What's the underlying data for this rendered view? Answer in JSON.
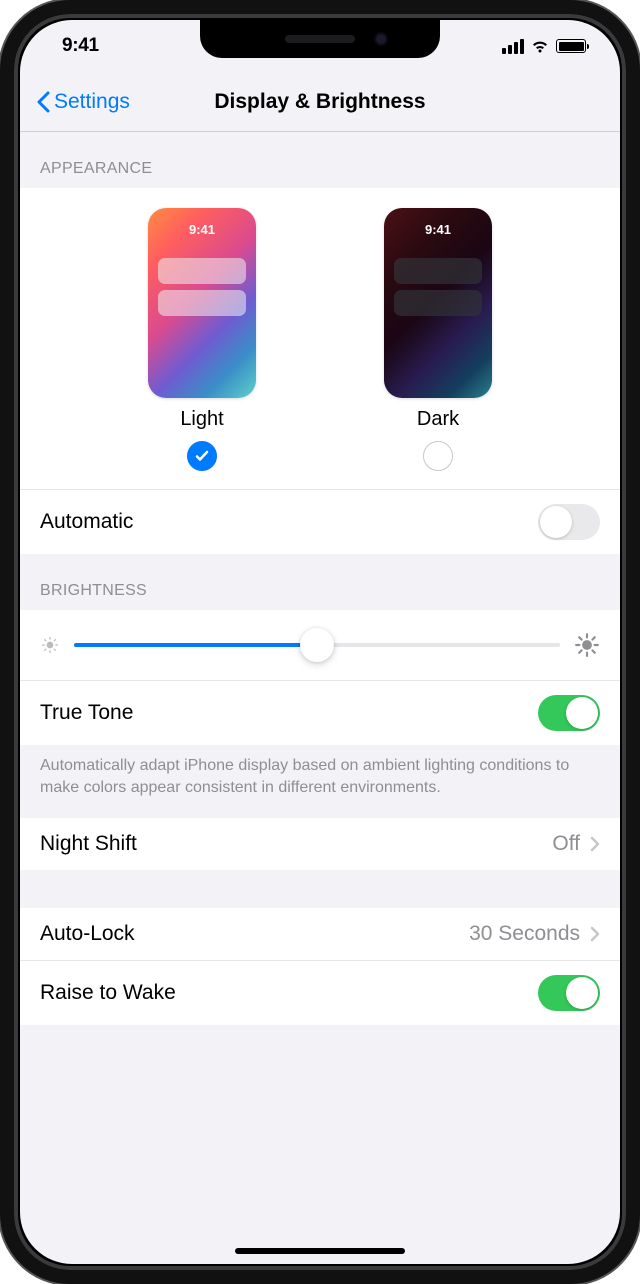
{
  "status": {
    "time": "9:41"
  },
  "nav": {
    "back": "Settings",
    "title": "Display & Brightness"
  },
  "sections": {
    "appearance": {
      "header": "Appearance",
      "options": [
        {
          "label": "Light",
          "time": "9:41",
          "selected": true
        },
        {
          "label": "Dark",
          "time": "9:41",
          "selected": false
        }
      ],
      "automatic": {
        "label": "Automatic",
        "enabled": false
      }
    },
    "brightness": {
      "header": "Brightness",
      "slider_value": 0.5,
      "true_tone": {
        "label": "True Tone",
        "enabled": true
      },
      "true_tone_footer": "Automatically adapt iPhone display based on ambient lighting conditions to make colors appear consistent in different environments."
    },
    "night_shift": {
      "label": "Night Shift",
      "value": "Off"
    },
    "auto_lock": {
      "label": "Auto-Lock",
      "value": "30 Seconds"
    },
    "raise_to_wake": {
      "label": "Raise to Wake",
      "enabled": true
    }
  }
}
